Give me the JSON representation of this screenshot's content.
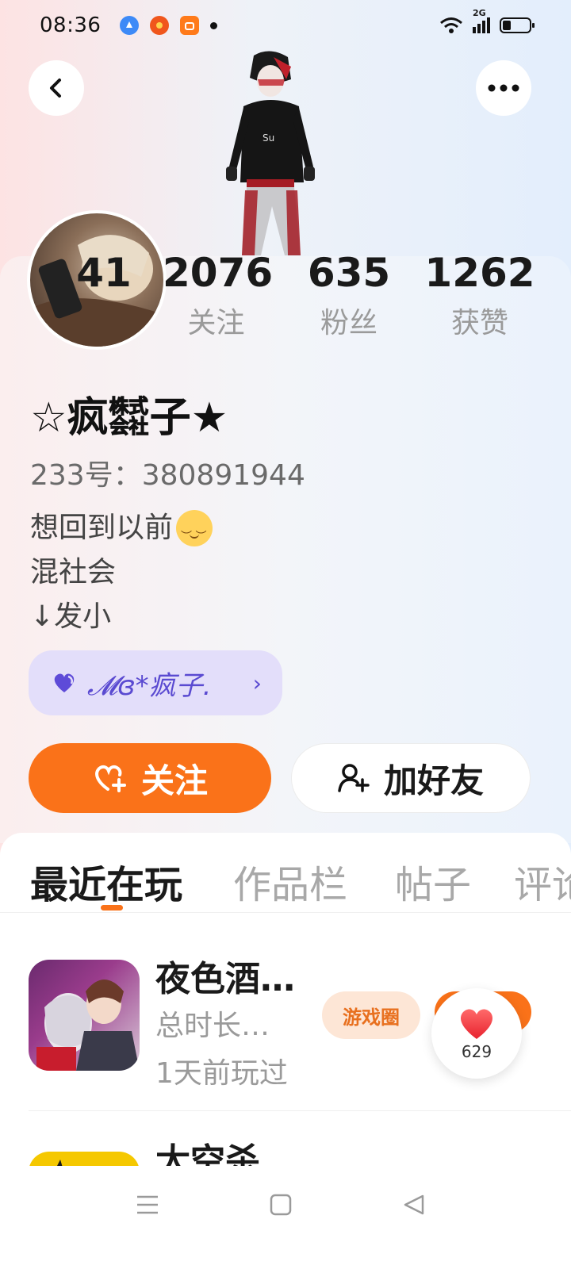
{
  "status_bar": {
    "time": "08:36",
    "notifications": [
      "blue-app-icon",
      "red-app-icon",
      "orange-app-icon"
    ],
    "network": "2G"
  },
  "header": {
    "back_icon": "chevron-left-icon",
    "more_icon": "more-dots-icon"
  },
  "stats": {
    "visits": {
      "value": "41",
      "label": ""
    },
    "following": {
      "value": "2076",
      "label": "关注"
    },
    "fans": {
      "value": "635",
      "label": "粉丝"
    },
    "likes": {
      "value": "1262",
      "label": "获赞"
    }
  },
  "profile": {
    "nickname": "☆疯㍿子★",
    "user_id": "233号：380891944",
    "bio": [
      "想回到以前",
      "混社会",
      "↓发小"
    ]
  },
  "fan_badge": {
    "text": "𝓜ɞ*疯子.",
    "arrow": "›",
    "icon": "heart-icon"
  },
  "actions": {
    "follow_label": "关注",
    "add_friend_label": "加好友"
  },
  "tabs": [
    {
      "label": "最近在玩",
      "active": true
    },
    {
      "label": "作品栏",
      "active": false
    },
    {
      "label": "帖子",
      "active": false
    },
    {
      "label": "评论",
      "active": false
    }
  ],
  "games": [
    {
      "title": "夜色酒…",
      "playtime": "总时长…",
      "last_played": "1天前玩过",
      "circle_button": "游戏圈"
    },
    {
      "title": "太空杀"
    }
  ],
  "like_float": {
    "count": "629",
    "icon": "heart-icon"
  },
  "nav": {
    "items": [
      "menu-icon",
      "home-icon",
      "back-icon"
    ]
  },
  "colors": {
    "accent": "#fa7219",
    "badge_bg": "#e3defa",
    "badge_text": "#5a4ad1"
  }
}
